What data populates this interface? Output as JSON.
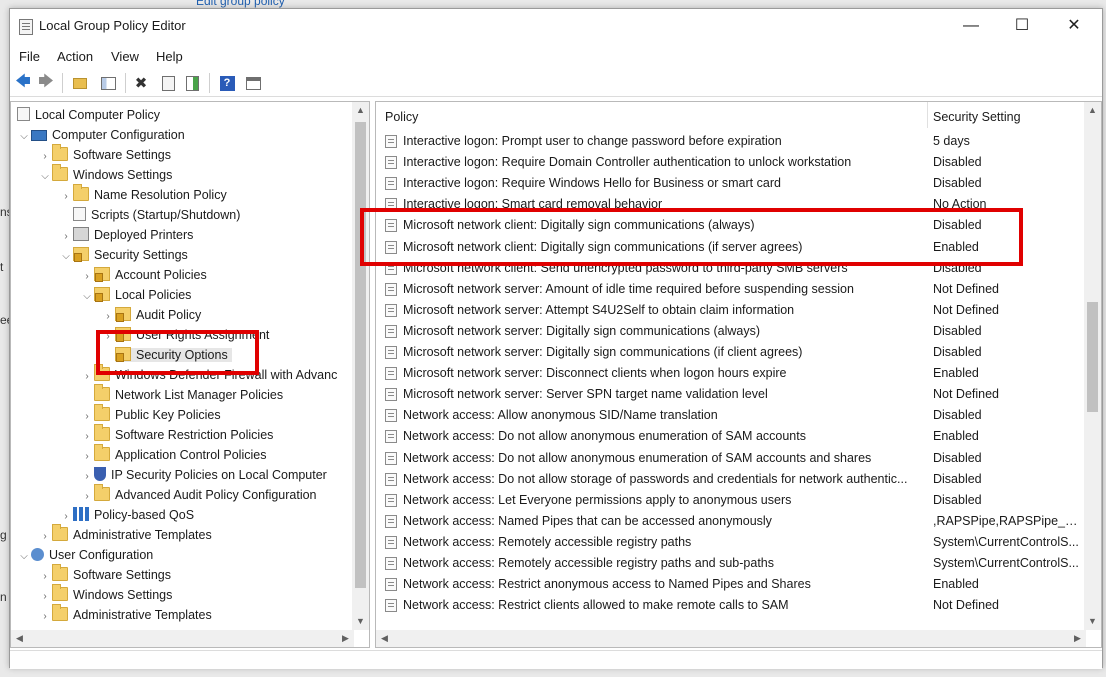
{
  "background": {
    "top_link": "Edit group policy"
  },
  "window": {
    "title": "Local Group Policy Editor",
    "controls": {
      "minimize": "—",
      "maximize": "☐",
      "close": "✕"
    }
  },
  "menubar": [
    "File",
    "Action",
    "View",
    "Help"
  ],
  "tree": {
    "items": [
      {
        "label": "Local Computer Policy"
      },
      {
        "label": "Computer Configuration"
      },
      {
        "label": "Software Settings"
      },
      {
        "label": "Windows Settings"
      },
      {
        "label": "Name Resolution Policy"
      },
      {
        "label": "Scripts (Startup/Shutdown)"
      },
      {
        "label": "Deployed Printers"
      },
      {
        "label": "Security Settings"
      },
      {
        "label": "Account Policies"
      },
      {
        "label": "Local Policies"
      },
      {
        "label": "Audit Policy"
      },
      {
        "label": "User Rights Assignment"
      },
      {
        "label": "Security Options"
      },
      {
        "label": "Windows Defender Firewall with Advanc"
      },
      {
        "label": "Network List Manager Policies"
      },
      {
        "label": "Public Key Policies"
      },
      {
        "label": "Software Restriction Policies"
      },
      {
        "label": "Application Control Policies"
      },
      {
        "label": "IP Security Policies on Local Computer"
      },
      {
        "label": "Advanced Audit Policy Configuration"
      },
      {
        "label": "Policy-based QoS"
      },
      {
        "label": "Administrative Templates"
      },
      {
        "label": "User Configuration"
      },
      {
        "label": "Software Settings"
      },
      {
        "label": "Windows Settings"
      },
      {
        "label": "Administrative Templates"
      }
    ]
  },
  "list": {
    "columns": {
      "policy": "Policy",
      "setting": "Security Setting"
    },
    "rows": [
      {
        "policy": "Interactive logon: Prompt user to change password before expiration",
        "setting": "5 days"
      },
      {
        "policy": "Interactive logon: Require Domain Controller authentication to unlock workstation",
        "setting": "Disabled"
      },
      {
        "policy": "Interactive logon: Require Windows Hello for Business or smart card",
        "setting": "Disabled"
      },
      {
        "policy": "Interactive logon: Smart card removal behavior",
        "setting": "No Action"
      },
      {
        "policy": "Microsoft network client: Digitally sign communications (always)",
        "setting": "Disabled"
      },
      {
        "policy": "Microsoft network client: Digitally sign communications (if server agrees)",
        "setting": "Enabled"
      },
      {
        "policy": "Microsoft network client: Send unencrypted password to third-party SMB servers",
        "setting": "Disabled"
      },
      {
        "policy": "Microsoft network server: Amount of idle time required before suspending session",
        "setting": "Not Defined"
      },
      {
        "policy": "Microsoft network server: Attempt S4U2Self to obtain claim information",
        "setting": "Not Defined"
      },
      {
        "policy": "Microsoft network server: Digitally sign communications (always)",
        "setting": "Disabled"
      },
      {
        "policy": "Microsoft network server: Digitally sign communications (if client agrees)",
        "setting": "Disabled"
      },
      {
        "policy": "Microsoft network server: Disconnect clients when logon hours expire",
        "setting": "Enabled"
      },
      {
        "policy": "Microsoft network server: Server SPN target name validation level",
        "setting": "Not Defined"
      },
      {
        "policy": "Network access: Allow anonymous SID/Name translation",
        "setting": "Disabled"
      },
      {
        "policy": "Network access: Do not allow anonymous enumeration of SAM accounts",
        "setting": "Enabled"
      },
      {
        "policy": "Network access: Do not allow anonymous enumeration of SAM accounts and shares",
        "setting": "Disabled"
      },
      {
        "policy": "Network access: Do not allow storage of passwords and credentials for network authentic...",
        "setting": "Disabled"
      },
      {
        "policy": "Network access: Let Everyone permissions apply to anonymous users",
        "setting": "Disabled"
      },
      {
        "policy": "Network access: Named Pipes that can be accessed anonymously",
        "setting": ",RAPSPipe,RAPSPipe_N,RA..."
      },
      {
        "policy": "Network access: Remotely accessible registry paths",
        "setting": "System\\CurrentControlS..."
      },
      {
        "policy": "Network access: Remotely accessible registry paths and sub-paths",
        "setting": "System\\CurrentControlS..."
      },
      {
        "policy": "Network access: Restrict anonymous access to Named Pipes and Shares",
        "setting": "Enabled"
      },
      {
        "policy": "Network access: Restrict clients allowed to make remote calls to SAM",
        "setting": "Not Defined"
      }
    ]
  },
  "colors": {
    "highlight": "#e00000",
    "selection": "#e6e6e6"
  }
}
